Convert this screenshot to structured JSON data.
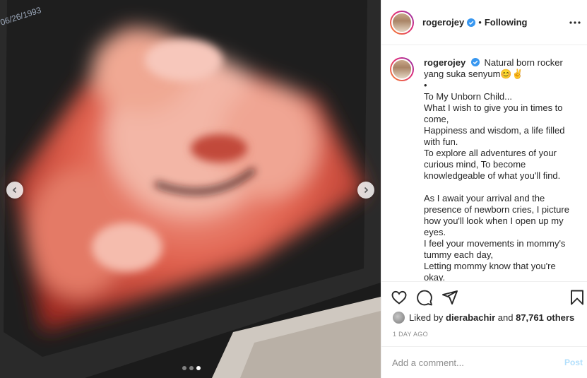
{
  "media": {
    "screen_date": "06/26/1993",
    "carousel_dots": 3,
    "active_dot": 3
  },
  "header": {
    "username": "rogerojey",
    "separator": "•",
    "follow_status": "Following"
  },
  "caption": {
    "username": "rogerojey",
    "lines": [
      "Natural born rocker yang suka senyum😊✌️",
      "•",
      "To My Unborn Child...",
      "What I wish to give you in times to come,",
      "Happiness and wisdom, a life filled with fun.",
      "To explore all adventures of your curious mind, To become knowledgeable of what you'll find.",
      "",
      "As I await your arrival and the presence of newborn cries, I picture how you'll look when I open up my eyes.",
      "I feel your movements in mommy's tummy each day,",
      "Letting mommy know that you're okay."
    ]
  },
  "likes": {
    "prefix": "Liked by",
    "liker": "dierabachir",
    "conjunction": "and",
    "others": "87,761 others"
  },
  "timestamp": "1 DAY AGO",
  "comment": {
    "placeholder": "Add a comment...",
    "post_label": "Post"
  },
  "icons": {
    "verified": "verified-badge-icon",
    "more": "more-options-icon",
    "like": "heart-icon",
    "comment": "comment-icon",
    "share": "share-icon",
    "save": "bookmark-icon",
    "prev": "chevron-left-icon",
    "next": "chevron-right-icon"
  },
  "colors": {
    "verified_blue": "#3897f0",
    "post_disabled": "#b2dffc",
    "muted": "#8e8e8e"
  }
}
